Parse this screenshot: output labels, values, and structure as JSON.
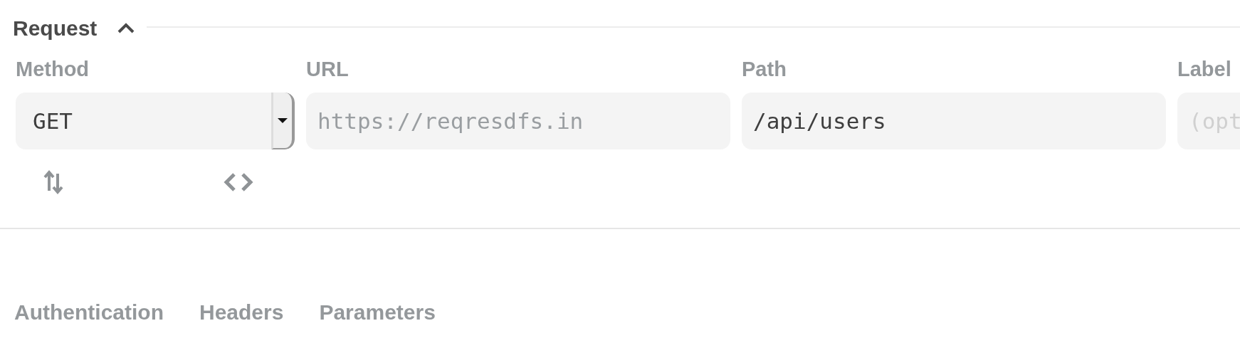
{
  "section": {
    "title": "Request",
    "expanded": true
  },
  "fields": [
    {
      "kind": "select",
      "label": "Method",
      "value": "GET"
    },
    {
      "kind": "text",
      "label": "URL",
      "placeholder": "https://reqresdfs.in"
    },
    {
      "kind": "text",
      "label": "Path",
      "value": "/api/users"
    },
    {
      "kind": "text",
      "label": "Label",
      "placeholder": "(opt"
    }
  ],
  "tabs": [
    {
      "label": "Authentication",
      "selected": false
    },
    {
      "label": "Headers",
      "selected": false
    },
    {
      "label": "Parameters",
      "selected": false
    }
  ]
}
